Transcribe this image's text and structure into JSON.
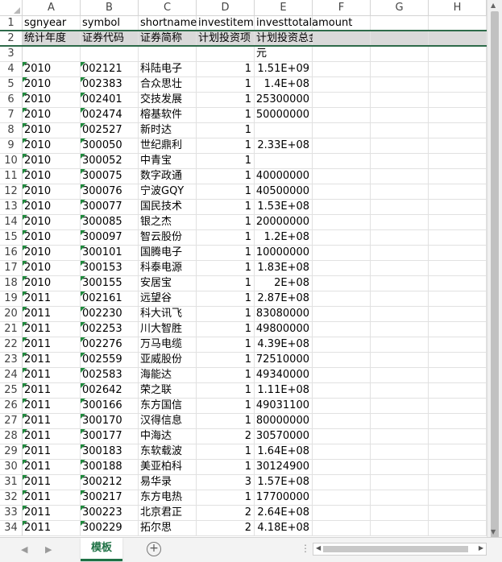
{
  "columns": [
    "A",
    "B",
    "C",
    "D",
    "E",
    "F",
    "G",
    "H"
  ],
  "rows": [
    {
      "n": "1",
      "a": "sgnyear",
      "b": "symbol",
      "c": "shortname",
      "d": "investitemn",
      "e": "investtotalamount"
    },
    {
      "n": "2",
      "a": "统计年度",
      "b": "证券代码",
      "c": "证券简称",
      "d": "计划投资项",
      "e": "计划投资总金额"
    },
    {
      "n": "3",
      "a": "",
      "b": "",
      "c": "",
      "d": "",
      "e": "元"
    },
    {
      "n": "4",
      "a": "2010",
      "b": "002121",
      "c": "科陆电子",
      "d": "1",
      "e": "1.51E+09"
    },
    {
      "n": "5",
      "a": "2010",
      "b": "002383",
      "c": "合众思壮",
      "d": "1",
      "e": "1.4E+08"
    },
    {
      "n": "6",
      "a": "2010",
      "b": "002401",
      "c": "交技发展",
      "d": "1",
      "e": "25300000"
    },
    {
      "n": "7",
      "a": "2010",
      "b": "002474",
      "c": "榕基软件",
      "d": "1",
      "e": "50000000"
    },
    {
      "n": "8",
      "a": "2010",
      "b": "002527",
      "c": "新时达",
      "d": "1",
      "e": ""
    },
    {
      "n": "9",
      "a": "2010",
      "b": "300050",
      "c": "世纪鼎利",
      "d": "1",
      "e": "2.33E+08"
    },
    {
      "n": "10",
      "a": "2010",
      "b": "300052",
      "c": "中青宝",
      "d": "1",
      "e": ""
    },
    {
      "n": "11",
      "a": "2010",
      "b": "300075",
      "c": "数字政通",
      "d": "1",
      "e": "40000000"
    },
    {
      "n": "12",
      "a": "2010",
      "b": "300076",
      "c": "宁波GQY",
      "d": "1",
      "e": "40500000"
    },
    {
      "n": "13",
      "a": "2010",
      "b": "300077",
      "c": "国民技术",
      "d": "1",
      "e": "1.53E+08"
    },
    {
      "n": "14",
      "a": "2010",
      "b": "300085",
      "c": "银之杰",
      "d": "1",
      "e": "20000000"
    },
    {
      "n": "15",
      "a": "2010",
      "b": "300097",
      "c": "智云股份",
      "d": "1",
      "e": "1.2E+08"
    },
    {
      "n": "16",
      "a": "2010",
      "b": "300101",
      "c": "国腾电子",
      "d": "1",
      "e": "10000000"
    },
    {
      "n": "17",
      "a": "2010",
      "b": "300153",
      "c": "科泰电源",
      "d": "1",
      "e": "1.83E+08"
    },
    {
      "n": "18",
      "a": "2010",
      "b": "300155",
      "c": "安居宝",
      "d": "1",
      "e": "2E+08"
    },
    {
      "n": "19",
      "a": "2011",
      "b": "002161",
      "c": "远望谷",
      "d": "1",
      "e": "2.87E+08"
    },
    {
      "n": "20",
      "a": "2011",
      "b": "002230",
      "c": "科大讯飞",
      "d": "1",
      "e": "83080000"
    },
    {
      "n": "21",
      "a": "2011",
      "b": "002253",
      "c": "川大智胜",
      "d": "1",
      "e": "49800000"
    },
    {
      "n": "22",
      "a": "2011",
      "b": "002276",
      "c": "万马电缆",
      "d": "1",
      "e": "4.39E+08"
    },
    {
      "n": "23",
      "a": "2011",
      "b": "002559",
      "c": "亚威股份",
      "d": "1",
      "e": "72510000"
    },
    {
      "n": "24",
      "a": "2011",
      "b": "002583",
      "c": "海能达",
      "d": "1",
      "e": "49340000"
    },
    {
      "n": "25",
      "a": "2011",
      "b": "002642",
      "c": "荣之联",
      "d": "1",
      "e": "1.11E+08"
    },
    {
      "n": "26",
      "a": "2011",
      "b": "300166",
      "c": "东方国信",
      "d": "1",
      "e": "49031100"
    },
    {
      "n": "27",
      "a": "2011",
      "b": "300170",
      "c": "汉得信息",
      "d": "1",
      "e": "80000000"
    },
    {
      "n": "28",
      "a": "2011",
      "b": "300177",
      "c": "中海达",
      "d": "2",
      "e": "30570000"
    },
    {
      "n": "29",
      "a": "2011",
      "b": "300183",
      "c": "东软载波",
      "d": "1",
      "e": "1.64E+08"
    },
    {
      "n": "30",
      "a": "2011",
      "b": "300188",
      "c": "美亚柏科",
      "d": "1",
      "e": "30124900"
    },
    {
      "n": "31",
      "a": "2011",
      "b": "300212",
      "c": "易华录",
      "d": "3",
      "e": "1.57E+08"
    },
    {
      "n": "32",
      "a": "2011",
      "b": "300217",
      "c": "东方电热",
      "d": "1",
      "e": "17700000"
    },
    {
      "n": "33",
      "a": "2011",
      "b": "300223",
      "c": "北京君正",
      "d": "2",
      "e": "2.64E+08"
    },
    {
      "n": "34",
      "a": "2011",
      "b": "300229",
      "c": "拓尔思",
      "d": "2",
      "e": "4.18E+08"
    }
  ],
  "sheet_tab": "模板",
  "icons": {
    "add_sheet": "plus-circle-icon",
    "nav_left": "chevron-left-icon",
    "nav_right": "chevron-right-icon"
  },
  "colors": {
    "accent": "#1e7145",
    "triangle": "#1e8a3c",
    "header_fill": "#d9d9d9"
  }
}
